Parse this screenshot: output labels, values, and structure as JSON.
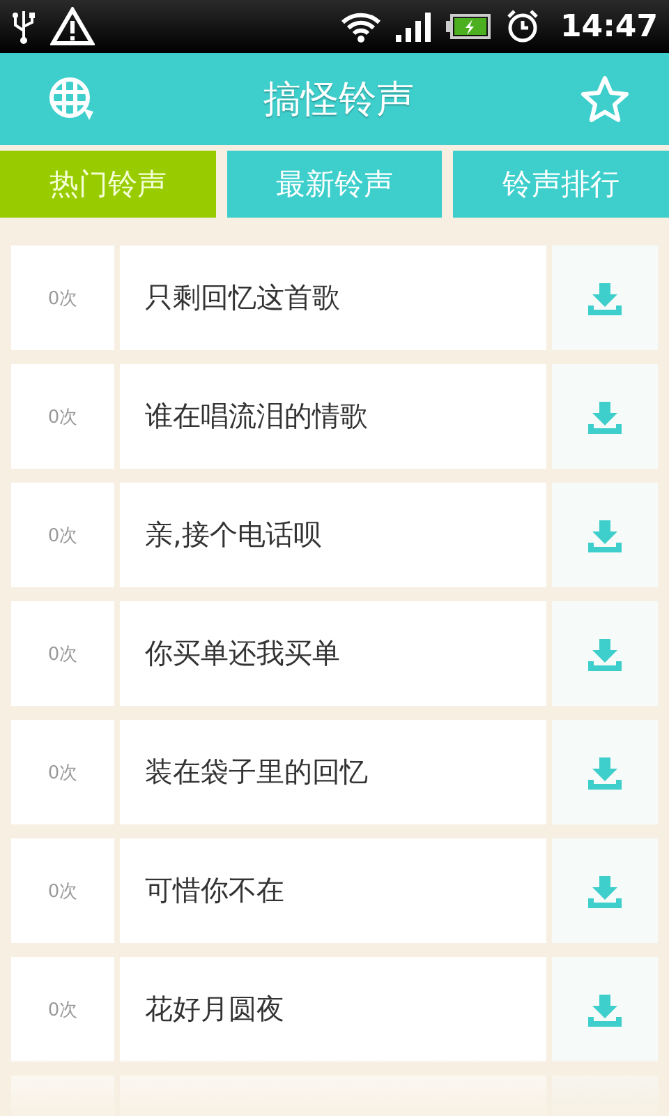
{
  "status_bar": {
    "time": "14:47"
  },
  "header": {
    "title": "搞怪铃声"
  },
  "tabs": [
    {
      "label": "热门铃声",
      "selected": true
    },
    {
      "label": "最新铃声",
      "selected": false
    },
    {
      "label": "铃声排行",
      "selected": false
    }
  ],
  "ringtones": [
    {
      "count": "0次",
      "title": "只剩回忆这首歌"
    },
    {
      "count": "0次",
      "title": "谁在唱流泪的情歌"
    },
    {
      "count": "0次",
      "title": "亲,接个电话呗"
    },
    {
      "count": "0次",
      "title": "你买单还我买单"
    },
    {
      "count": "0次",
      "title": "装在袋子里的回忆"
    },
    {
      "count": "0次",
      "title": "可惜你不在"
    },
    {
      "count": "0次",
      "title": "花好月圆夜"
    }
  ]
}
